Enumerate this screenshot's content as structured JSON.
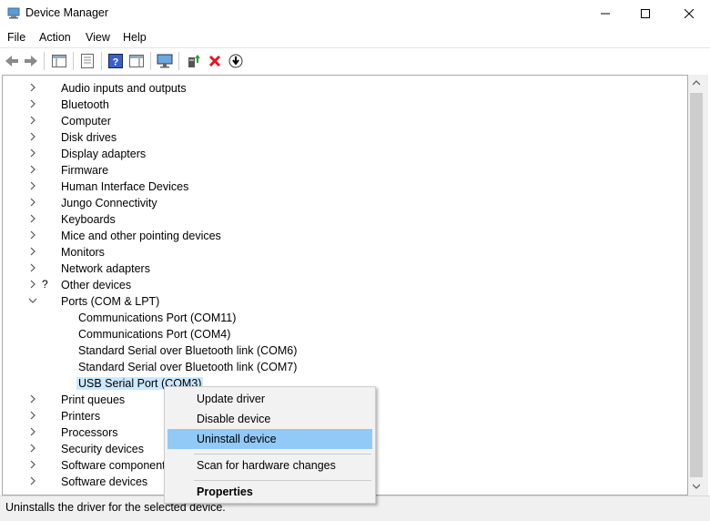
{
  "window": {
    "title": "Device Manager",
    "controls": [
      "minimize",
      "maximize",
      "close"
    ]
  },
  "menubar": {
    "items": [
      "File",
      "Action",
      "View",
      "Help"
    ]
  },
  "toolbar": {
    "buttons": [
      {
        "name": "back-icon",
        "glyph": "back"
      },
      {
        "name": "forward-icon",
        "glyph": "forward"
      },
      {
        "name": "show-hide-console-tree-icon",
        "glyph": "console"
      },
      {
        "name": "properties-icon",
        "glyph": "properties"
      },
      {
        "name": "help-icon",
        "glyph": "help"
      },
      {
        "name": "action-pane-icon",
        "glyph": "pane"
      },
      {
        "name": "scan-hardware-icon",
        "glyph": "monitor"
      },
      {
        "name": "update-driver-icon",
        "glyph": "update"
      },
      {
        "name": "uninstall-device-icon",
        "glyph": "x"
      },
      {
        "name": "disable-device-icon",
        "glyph": "down"
      }
    ]
  },
  "tree": {
    "categories": [
      {
        "label": "Audio inputs and outputs",
        "icon": "speaker-icon"
      },
      {
        "label": "Bluetooth",
        "icon": "bluetooth-icon"
      },
      {
        "label": "Computer",
        "icon": "computer-icon"
      },
      {
        "label": "Disk drives",
        "icon": "disk-drive-icon"
      },
      {
        "label": "Display adapters",
        "icon": "display-adapter-icon"
      },
      {
        "label": "Firmware",
        "icon": "firmware-icon"
      },
      {
        "label": "Human Interface Devices",
        "icon": "hid-icon"
      },
      {
        "label": "Jungo Connectivity",
        "icon": "jungo-icon"
      },
      {
        "label": "Keyboards",
        "icon": "keyboard-icon"
      },
      {
        "label": "Mice and other pointing devices",
        "icon": "mouse-icon"
      },
      {
        "label": "Monitors",
        "icon": "monitor-icon"
      },
      {
        "label": "Network adapters",
        "icon": "network-adapter-icon"
      },
      {
        "label": "Other devices",
        "icon": "other-devices-icon"
      },
      {
        "label": "Ports (COM & LPT)",
        "icon": "port-icon",
        "expanded": true,
        "children": [
          {
            "label": "Communications Port (COM11)",
            "icon": "warning-port-icon"
          },
          {
            "label": "Communications Port (COM4)",
            "icon": "warning-port-icon"
          },
          {
            "label": "Standard Serial over Bluetooth link (COM6)",
            "icon": "port-icon"
          },
          {
            "label": "Standard Serial over Bluetooth link (COM7)",
            "icon": "port-icon"
          },
          {
            "label": "USB Serial Port (COM3)",
            "icon": "port-icon",
            "selected": true
          }
        ]
      },
      {
        "label": "Print queues",
        "icon": "print-queue-icon"
      },
      {
        "label": "Printers",
        "icon": "printer-icon"
      },
      {
        "label": "Processors",
        "icon": "processor-icon"
      },
      {
        "label": "Security devices",
        "icon": "security-device-icon"
      },
      {
        "label": "Software components",
        "icon": "software-component-icon"
      },
      {
        "label": "Software devices",
        "icon": "software-device-icon"
      }
    ]
  },
  "context_menu": {
    "items": [
      {
        "label": "Update driver"
      },
      {
        "label": "Disable device"
      },
      {
        "label": "Uninstall device",
        "highlighted": true
      },
      {
        "label": "Scan for hardware changes"
      },
      {
        "label": "Properties",
        "bold": true
      }
    ]
  },
  "statusbar": {
    "text": "Uninstalls the driver for the selected device."
  },
  "colors": {
    "selection": "#cce8ff",
    "menu_highlight": "#91c9f7",
    "uninstall_red": "#e81123"
  }
}
